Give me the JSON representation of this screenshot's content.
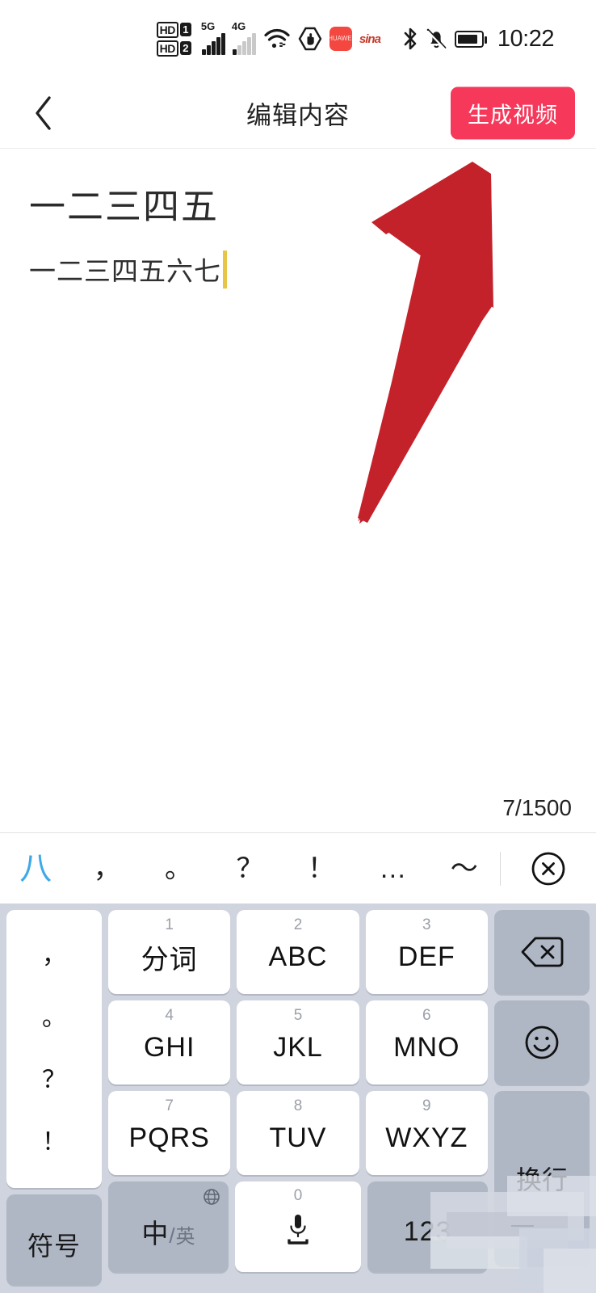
{
  "statusbar": {
    "hd1_label": "HD",
    "hd1_num": "1",
    "hd2_label": "HD",
    "hd2_num": "2",
    "net1": "5G",
    "net2": "4G",
    "icons": [
      "hd-dual-sim-icon",
      "signal-5g-icon",
      "signal-4g-icon",
      "wifi-icon",
      "do-not-disturb-icon",
      "huawei-app-icon",
      "sina-app-icon",
      "bluetooth-icon",
      "silent-bell-icon",
      "battery-icon"
    ],
    "sina_label": "sina",
    "time": "10:22"
  },
  "navbar": {
    "back_icon": "chevron-left-icon",
    "title": "编辑内容",
    "generate_label": "生成视频",
    "accent": "#F6395B"
  },
  "editor": {
    "title_text": "一二三四五",
    "body_text": "一二三四五六七",
    "caret_color": "#E8C547",
    "counter": "7/1500",
    "count_current": 7,
    "count_max": 1500
  },
  "annotation": {
    "arrow_name": "red-arrow-annotation",
    "color": "#C4222B"
  },
  "suggestbar": {
    "items": [
      {
        "text": "八",
        "highlight": true
      },
      {
        "text": "，",
        "highlight": false
      },
      {
        "text": "。",
        "highlight": false
      },
      {
        "text": "？",
        "highlight": false
      },
      {
        "text": "！",
        "highlight": false
      },
      {
        "text": "…",
        "highlight": false
      },
      {
        "text": "～",
        "highlight": false
      }
    ],
    "close_icon": "close-circle-icon"
  },
  "keyboard": {
    "punctuation_column": [
      "，",
      "。",
      "？",
      "！"
    ],
    "rows": [
      [
        {
          "num": "1",
          "label": "分词"
        },
        {
          "num": "2",
          "label": "ABC"
        },
        {
          "num": "3",
          "label": "DEF"
        }
      ],
      [
        {
          "num": "4",
          "label": "GHI"
        },
        {
          "num": "5",
          "label": "JKL"
        },
        {
          "num": "6",
          "label": "MNO"
        }
      ],
      [
        {
          "num": "7",
          "label": "PQRS"
        },
        {
          "num": "8",
          "label": "TUV"
        },
        {
          "num": "9",
          "label": "WXYZ"
        }
      ]
    ],
    "right_column": [
      {
        "icon": "backspace-icon",
        "label": ""
      },
      {
        "icon": "emoji-smiley-icon",
        "label": ""
      },
      {
        "icon": "",
        "label": "换行"
      }
    ],
    "bottom_row": {
      "symbols_label": "符号",
      "lang_cn": "中",
      "lang_sep": "/",
      "lang_en": "英",
      "globe_icon": "globe-icon",
      "space_num": "0",
      "space_icon": "microphone-icon",
      "numeric_label": "123"
    },
    "bg_color": "#CFD4DE",
    "key_color": "#FFFFFF",
    "func_key_color": "#AFB7C5"
  }
}
